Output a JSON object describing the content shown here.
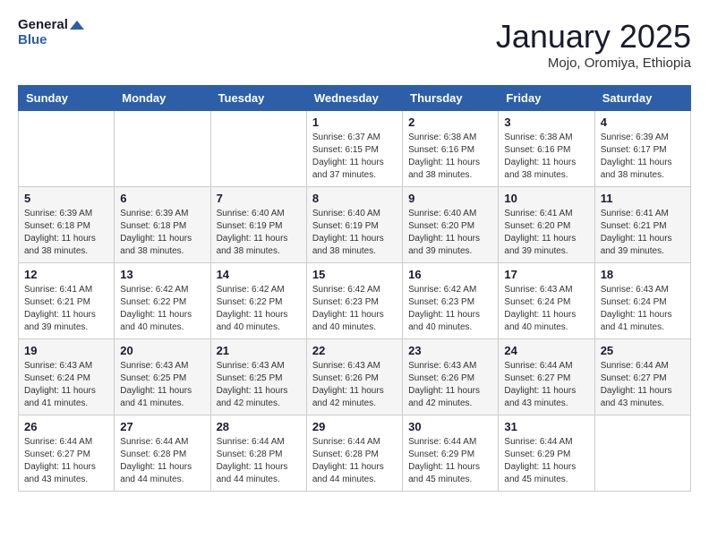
{
  "header": {
    "logo_line1": "General",
    "logo_line2": "Blue",
    "month_title": "January 2025",
    "subtitle": "Mojo, Oromiya, Ethiopia"
  },
  "days_of_week": [
    "Sunday",
    "Monday",
    "Tuesday",
    "Wednesday",
    "Thursday",
    "Friday",
    "Saturday"
  ],
  "weeks": [
    [
      {
        "day": "",
        "sunrise": "",
        "sunset": "",
        "daylight": ""
      },
      {
        "day": "",
        "sunrise": "",
        "sunset": "",
        "daylight": ""
      },
      {
        "day": "",
        "sunrise": "",
        "sunset": "",
        "daylight": ""
      },
      {
        "day": "1",
        "sunrise": "Sunrise: 6:37 AM",
        "sunset": "Sunset: 6:15 PM",
        "daylight": "Daylight: 11 hours and 37 minutes."
      },
      {
        "day": "2",
        "sunrise": "Sunrise: 6:38 AM",
        "sunset": "Sunset: 6:16 PM",
        "daylight": "Daylight: 11 hours and 38 minutes."
      },
      {
        "day": "3",
        "sunrise": "Sunrise: 6:38 AM",
        "sunset": "Sunset: 6:16 PM",
        "daylight": "Daylight: 11 hours and 38 minutes."
      },
      {
        "day": "4",
        "sunrise": "Sunrise: 6:39 AM",
        "sunset": "Sunset: 6:17 PM",
        "daylight": "Daylight: 11 hours and 38 minutes."
      }
    ],
    [
      {
        "day": "5",
        "sunrise": "Sunrise: 6:39 AM",
        "sunset": "Sunset: 6:18 PM",
        "daylight": "Daylight: 11 hours and 38 minutes."
      },
      {
        "day": "6",
        "sunrise": "Sunrise: 6:39 AM",
        "sunset": "Sunset: 6:18 PM",
        "daylight": "Daylight: 11 hours and 38 minutes."
      },
      {
        "day": "7",
        "sunrise": "Sunrise: 6:40 AM",
        "sunset": "Sunset: 6:19 PM",
        "daylight": "Daylight: 11 hours and 38 minutes."
      },
      {
        "day": "8",
        "sunrise": "Sunrise: 6:40 AM",
        "sunset": "Sunset: 6:19 PM",
        "daylight": "Daylight: 11 hours and 38 minutes."
      },
      {
        "day": "9",
        "sunrise": "Sunrise: 6:40 AM",
        "sunset": "Sunset: 6:20 PM",
        "daylight": "Daylight: 11 hours and 39 minutes."
      },
      {
        "day": "10",
        "sunrise": "Sunrise: 6:41 AM",
        "sunset": "Sunset: 6:20 PM",
        "daylight": "Daylight: 11 hours and 39 minutes."
      },
      {
        "day": "11",
        "sunrise": "Sunrise: 6:41 AM",
        "sunset": "Sunset: 6:21 PM",
        "daylight": "Daylight: 11 hours and 39 minutes."
      }
    ],
    [
      {
        "day": "12",
        "sunrise": "Sunrise: 6:41 AM",
        "sunset": "Sunset: 6:21 PM",
        "daylight": "Daylight: 11 hours and 39 minutes."
      },
      {
        "day": "13",
        "sunrise": "Sunrise: 6:42 AM",
        "sunset": "Sunset: 6:22 PM",
        "daylight": "Daylight: 11 hours and 40 minutes."
      },
      {
        "day": "14",
        "sunrise": "Sunrise: 6:42 AM",
        "sunset": "Sunset: 6:22 PM",
        "daylight": "Daylight: 11 hours and 40 minutes."
      },
      {
        "day": "15",
        "sunrise": "Sunrise: 6:42 AM",
        "sunset": "Sunset: 6:23 PM",
        "daylight": "Daylight: 11 hours and 40 minutes."
      },
      {
        "day": "16",
        "sunrise": "Sunrise: 6:42 AM",
        "sunset": "Sunset: 6:23 PM",
        "daylight": "Daylight: 11 hours and 40 minutes."
      },
      {
        "day": "17",
        "sunrise": "Sunrise: 6:43 AM",
        "sunset": "Sunset: 6:24 PM",
        "daylight": "Daylight: 11 hours and 40 minutes."
      },
      {
        "day": "18",
        "sunrise": "Sunrise: 6:43 AM",
        "sunset": "Sunset: 6:24 PM",
        "daylight": "Daylight: 11 hours and 41 minutes."
      }
    ],
    [
      {
        "day": "19",
        "sunrise": "Sunrise: 6:43 AM",
        "sunset": "Sunset: 6:24 PM",
        "daylight": "Daylight: 11 hours and 41 minutes."
      },
      {
        "day": "20",
        "sunrise": "Sunrise: 6:43 AM",
        "sunset": "Sunset: 6:25 PM",
        "daylight": "Daylight: 11 hours and 41 minutes."
      },
      {
        "day": "21",
        "sunrise": "Sunrise: 6:43 AM",
        "sunset": "Sunset: 6:25 PM",
        "daylight": "Daylight: 11 hours and 42 minutes."
      },
      {
        "day": "22",
        "sunrise": "Sunrise: 6:43 AM",
        "sunset": "Sunset: 6:26 PM",
        "daylight": "Daylight: 11 hours and 42 minutes."
      },
      {
        "day": "23",
        "sunrise": "Sunrise: 6:43 AM",
        "sunset": "Sunset: 6:26 PM",
        "daylight": "Daylight: 11 hours and 42 minutes."
      },
      {
        "day": "24",
        "sunrise": "Sunrise: 6:44 AM",
        "sunset": "Sunset: 6:27 PM",
        "daylight": "Daylight: 11 hours and 43 minutes."
      },
      {
        "day": "25",
        "sunrise": "Sunrise: 6:44 AM",
        "sunset": "Sunset: 6:27 PM",
        "daylight": "Daylight: 11 hours and 43 minutes."
      }
    ],
    [
      {
        "day": "26",
        "sunrise": "Sunrise: 6:44 AM",
        "sunset": "Sunset: 6:27 PM",
        "daylight": "Daylight: 11 hours and 43 minutes."
      },
      {
        "day": "27",
        "sunrise": "Sunrise: 6:44 AM",
        "sunset": "Sunset: 6:28 PM",
        "daylight": "Daylight: 11 hours and 44 minutes."
      },
      {
        "day": "28",
        "sunrise": "Sunrise: 6:44 AM",
        "sunset": "Sunset: 6:28 PM",
        "daylight": "Daylight: 11 hours and 44 minutes."
      },
      {
        "day": "29",
        "sunrise": "Sunrise: 6:44 AM",
        "sunset": "Sunset: 6:28 PM",
        "daylight": "Daylight: 11 hours and 44 minutes."
      },
      {
        "day": "30",
        "sunrise": "Sunrise: 6:44 AM",
        "sunset": "Sunset: 6:29 PM",
        "daylight": "Daylight: 11 hours and 45 minutes."
      },
      {
        "day": "31",
        "sunrise": "Sunrise: 6:44 AM",
        "sunset": "Sunset: 6:29 PM",
        "daylight": "Daylight: 11 hours and 45 minutes."
      },
      {
        "day": "",
        "sunrise": "",
        "sunset": "",
        "daylight": ""
      }
    ]
  ]
}
